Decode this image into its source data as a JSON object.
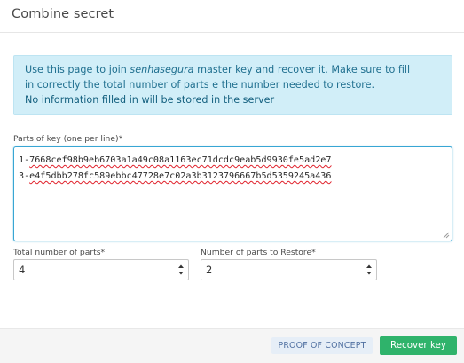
{
  "header": {
    "title": "Combine secret"
  },
  "alert": {
    "line1_prefix": "Use this page to join ",
    "brand": "senhasegura",
    "line1_suffix": " master key and recover it. Make sure to fill",
    "line2": "in correctly the total number of parts e the number needed to restore.",
    "line3": "No information filled in will be stored in the server"
  },
  "keys": {
    "label": "Parts of key (one per line)*",
    "lines": [
      {
        "prefix": "1-",
        "value": "7668cef98b9eb6703a1a49c08a1163ec71dcdc9eab5d9930fe5ad2e7"
      },
      {
        "prefix": "3-",
        "value": "e4f5dbb278fc589ebbc47728e7c02a3b3123796667b5d5359245a436"
      }
    ]
  },
  "total_parts": {
    "label": "Total number of parts*",
    "value": "4"
  },
  "restore_parts": {
    "label": "Number of parts to Restore*",
    "value": "2"
  },
  "footer": {
    "proof_label": "PROOF OF CONCEPT",
    "recover_label": "Recover key"
  },
  "colors": {
    "alert_bg": "#d1eef8",
    "alert_text": "#1f6f8f",
    "focus_border": "#38a6d4",
    "primary_button": "#2fb36b",
    "proof_button_bg": "#e6eef7"
  }
}
